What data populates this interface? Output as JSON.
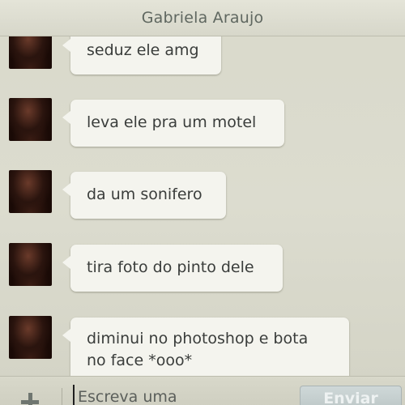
{
  "header": {
    "title": "Gabriela Araujo"
  },
  "messages": [
    {
      "text": "seduz ele amg"
    },
    {
      "text": "leva ele pra um motel"
    },
    {
      "text": "da um sonifero"
    },
    {
      "text": "tira foto do pinto dele"
    },
    {
      "text": "diminui no photoshop e bota\nno face *ooo*"
    }
  ],
  "composer": {
    "placeholder": "Escreva uma",
    "send_label": "Enviar",
    "attach_icon": "plus-icon"
  },
  "colors": {
    "background": "#d9d9cb",
    "bubble": "#f4f4ee",
    "text": "#3a3d3b",
    "header_text": "#5f6760"
  }
}
